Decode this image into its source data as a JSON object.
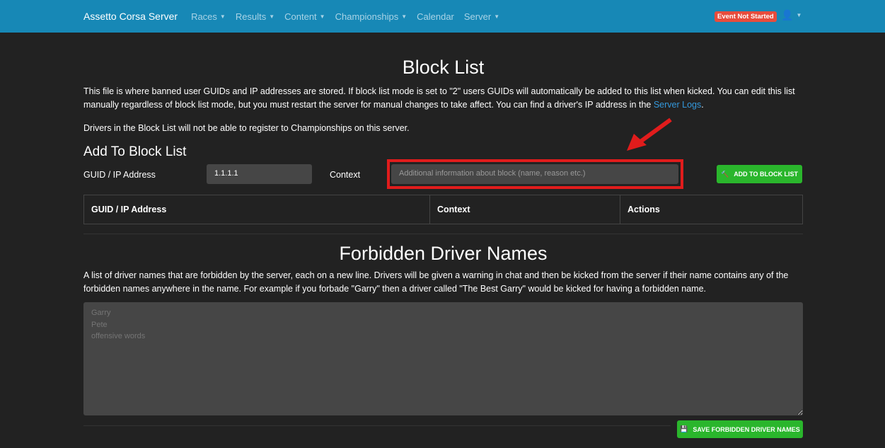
{
  "nav": {
    "brand": "Assetto Corsa Server",
    "items": [
      {
        "label": "Races",
        "dropdown": true
      },
      {
        "label": "Results",
        "dropdown": true
      },
      {
        "label": "Content",
        "dropdown": true
      },
      {
        "label": "Championships",
        "dropdown": true
      },
      {
        "label": "Calendar",
        "dropdown": false
      },
      {
        "label": "Server",
        "dropdown": true
      }
    ],
    "status_badge": "Event Not Started"
  },
  "block_list": {
    "title": "Block List",
    "desc_before_link": "This file is where banned user GUIDs and IP addresses are stored. If block list mode is set to \"2\" users GUIDs will automatically be added to this list when kicked. You can edit this list manually regardless of block list mode, but you must restart the server for manual changes to take affect. You can find a driver's IP address in the ",
    "link": "Server Logs",
    "desc_after_link": ".",
    "note": "Drivers in the Block List will not be able to register to Championships on this server.",
    "add_heading": "Add To Block List",
    "guid_label": "GUID / IP Address",
    "guid_value": "1.1.1.1",
    "context_label": "Context",
    "context_placeholder": "Additional information about block (name, reason etc.)",
    "add_button": "ADD TO BLOCK LIST",
    "columns": [
      "GUID / IP Address",
      "Context",
      "Actions"
    ]
  },
  "forbidden": {
    "title": "Forbidden Driver Names",
    "desc": "A list of driver names that are forbidden by the server, each on a new line. Drivers will be given a warning in chat and then be kicked from the server if their name contains any of the forbidden names anywhere in the name. For example if you forbade \"Garry\" then a driver called \"The Best Garry\" would be kicked for having a forbidden name.",
    "placeholder": "Garry\nPete\noffensive words",
    "save_button": "SAVE FORBIDDEN DRIVER NAMES"
  },
  "colors": {
    "nav": "#1788b6",
    "accent": "#2ab62c",
    "highlight": "#e11c1c"
  }
}
